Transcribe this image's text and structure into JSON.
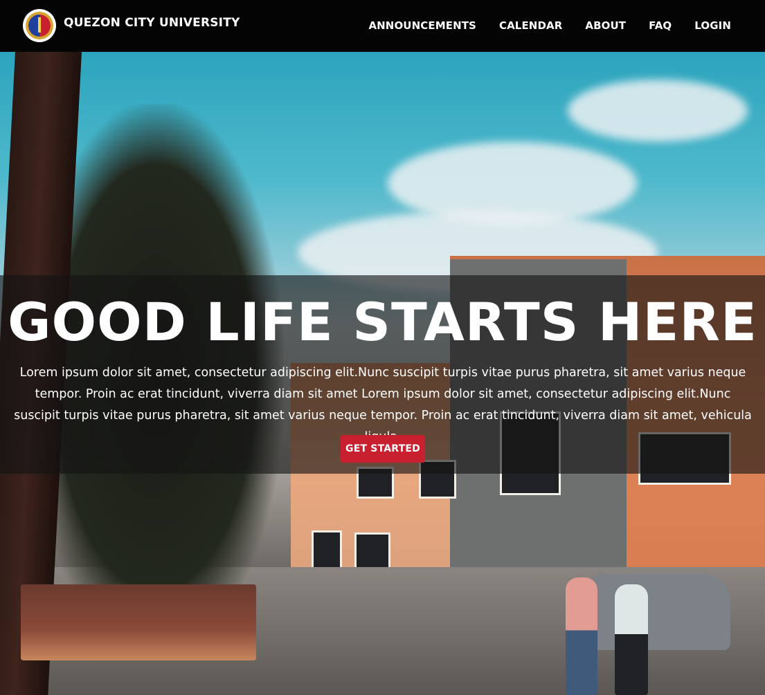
{
  "navbar": {
    "brand_name": "QUEZON CITY UNIVERSITY",
    "logo_icon": "university-seal-icon",
    "links": [
      "ANNOUNCEMENTS",
      "CALENDAR",
      "ABOUT",
      "FAQ",
      "LOGIN"
    ]
  },
  "hero": {
    "headline": "GOOD LIFE STARTS HERE",
    "lede": "Lorem ipsum dolor sit amet, consectetur adipiscing elit.Nunc suscipit turpis vitae purus pharetra, sit amet varius neque tempor. Proin ac erat tincidunt, viverra diam sit amet Lorem ipsum dolor sit amet, consectetur adipiscing elit.Nunc suscipit turpis vitae purus pharetra, sit amet varius neque tempor. Proin ac erat tincidunt, viverra diam sit amet, vehicula ligula.",
    "cta_label": "GET STARTED"
  },
  "colors": {
    "navbar_bg": "#040404",
    "cta_bg": "#c8202f",
    "overlay": "rgba(20,20,20,0.62)"
  }
}
